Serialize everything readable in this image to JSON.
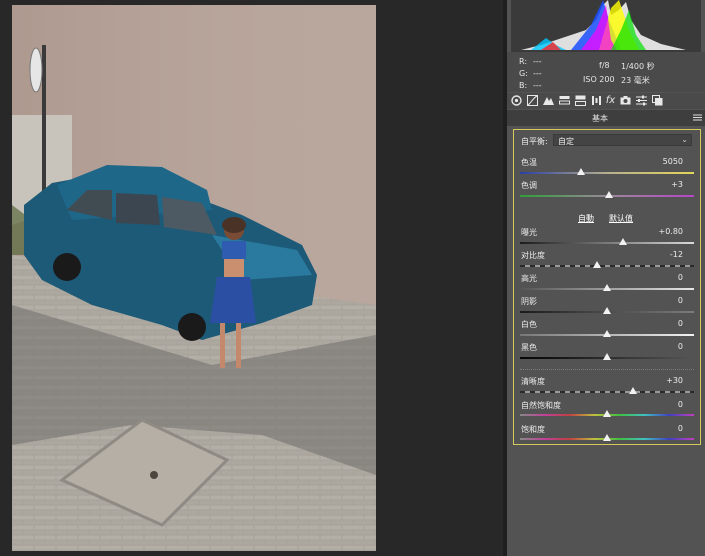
{
  "readout": {
    "r_label": "R:",
    "r_value": "---",
    "g_label": "G:",
    "g_value": "---",
    "b_label": "B:",
    "b_value": "---",
    "aperture": "f/8",
    "shutter": "1/400 秒",
    "iso": "ISO 200",
    "focal": "23 毫米"
  },
  "toolbar": {
    "icons": [
      "basic-icon",
      "tone-curve-icon",
      "detail-icon",
      "hsl-icon",
      "split-toning-icon",
      "lens-corrections-icon",
      "fx-icon",
      "camera-calibration-icon",
      "presets-icon",
      "snapshots-icon"
    ],
    "fx_glyph": "fx"
  },
  "panel": {
    "section_title": "基本",
    "white_balance_label": "自平衡:",
    "white_balance_value": "自定",
    "auto_link": "自動",
    "default_link": "默认值",
    "sliders": [
      {
        "key": "temperature",
        "label": "色温",
        "value": "5050",
        "position": 0.35
      },
      {
        "key": "tint",
        "label": "色调",
        "value": "+3",
        "position": 0.51
      },
      {
        "key": "exposure",
        "label": "曝光",
        "value": "+0.80",
        "position": 0.59
      },
      {
        "key": "contrast",
        "label": "对比度",
        "value": "-12",
        "position": 0.44
      },
      {
        "key": "highlights",
        "label": "高光",
        "value": "0",
        "position": 0.5
      },
      {
        "key": "shadows",
        "label": "阴影",
        "value": "0",
        "position": 0.5
      },
      {
        "key": "whites",
        "label": "白色",
        "value": "0",
        "position": 0.5
      },
      {
        "key": "blacks",
        "label": "黑色",
        "value": "0",
        "position": 0.5
      },
      {
        "key": "clarity",
        "label": "清晰度",
        "value": "+30",
        "position": 0.65
      },
      {
        "key": "vibrance",
        "label": "自然饱和度",
        "value": "0",
        "position": 0.5
      },
      {
        "key": "saturation",
        "label": "饱和度",
        "value": "0",
        "position": 0.5
      }
    ]
  },
  "colors": {
    "panel_bg": "#535353",
    "highlight_border": "#d4c95a",
    "canvas_bg": "#282828"
  }
}
